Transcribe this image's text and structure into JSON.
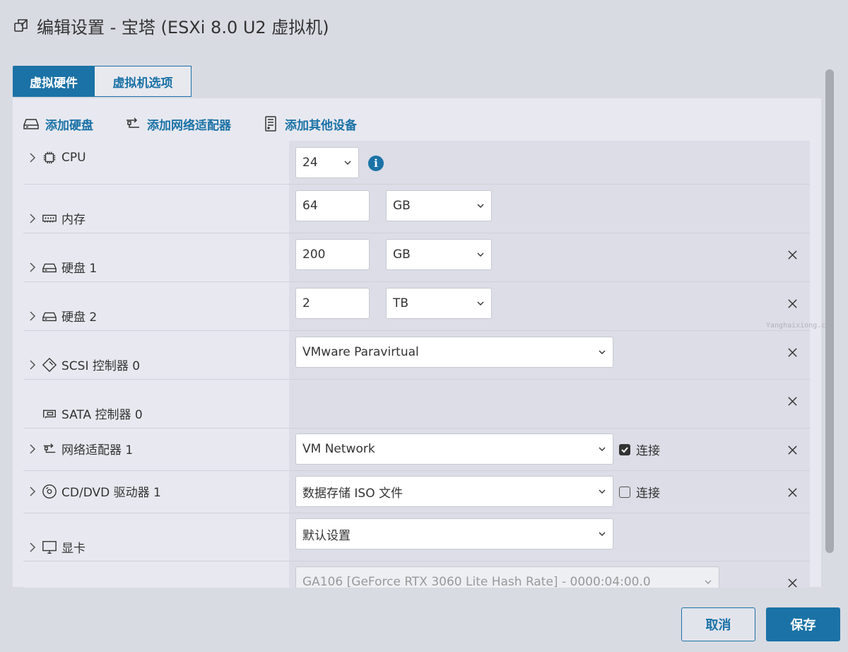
{
  "window": {
    "title": "编辑设置 - 宝塔 (ESXi 8.0 U2 虚拟机)",
    "title_icon": "edit-settings-icon"
  },
  "tabs": [
    {
      "label": "虚拟硬件",
      "active": true
    },
    {
      "label": "虚拟机选项",
      "active": false
    }
  ],
  "actions": {
    "add_disk": "添加硬盘",
    "add_network": "添加网络适配器",
    "add_other": "添加其他设备"
  },
  "devices": {
    "cpu": {
      "label": "CPU",
      "value": "24"
    },
    "memory": {
      "label": "内存",
      "value": "64",
      "unit": "GB"
    },
    "disk1": {
      "label": "硬盘 1",
      "value": "200",
      "unit": "GB"
    },
    "disk2": {
      "label": "硬盘 2",
      "value": "2",
      "unit": "TB"
    },
    "scsi": {
      "label": "SCSI 控制器 0",
      "value": "VMware Paravirtual"
    },
    "sata": {
      "label": "SATA 控制器 0"
    },
    "network": {
      "label": "网络适配器 1",
      "value": "VM Network",
      "connect_label": "连接",
      "connected": true
    },
    "cdrom": {
      "label": "CD/DVD 驱动器 1",
      "value": "数据存储 ISO 文件",
      "connect_label": "连接",
      "connected": false
    },
    "video": {
      "label": "显卡",
      "value": "默认设置"
    },
    "pci": {
      "value": "GA106 [GeForce RTX 3060 Lite Hash Rate] - 0000:04:00.0"
    }
  },
  "watermark": "Yanghaixiong.com",
  "buttons": {
    "cancel": "取消",
    "save": "保存"
  },
  "colors": {
    "accent": "#1b72a6"
  }
}
